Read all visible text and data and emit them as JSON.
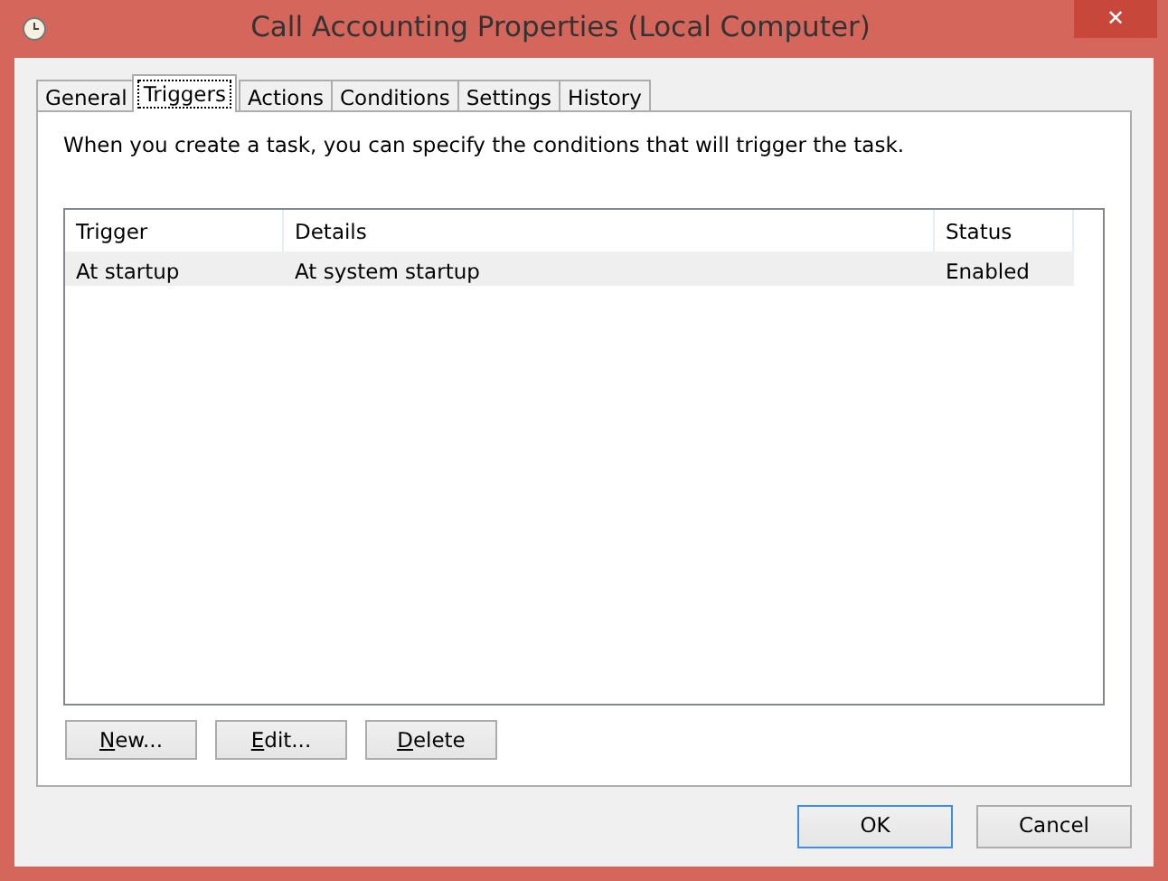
{
  "window": {
    "title": "Call Accounting Properties (Local Computer)",
    "close": "✕"
  },
  "tabs": [
    {
      "label": "General",
      "selected": false
    },
    {
      "label": "Triggers",
      "selected": true
    },
    {
      "label": "Actions",
      "selected": false
    },
    {
      "label": "Conditions",
      "selected": false
    },
    {
      "label": "Settings",
      "selected": false
    },
    {
      "label": "History",
      "selected": false
    }
  ],
  "description": "When you create a task, you can specify the conditions that will trigger the task.",
  "table": {
    "columns": [
      "Trigger",
      "Details",
      "Status"
    ],
    "rows": [
      {
        "cells": [
          "At startup",
          "At system startup",
          "Enabled"
        ],
        "selected": true
      }
    ]
  },
  "list_buttons": [
    {
      "access": "N",
      "rest": "ew..."
    },
    {
      "access": "E",
      "rest": "dit..."
    },
    {
      "access": "D",
      "rest": "elete"
    }
  ],
  "dialog_buttons": [
    {
      "label": "OK",
      "default": true
    },
    {
      "label": "Cancel",
      "default": false
    }
  ]
}
